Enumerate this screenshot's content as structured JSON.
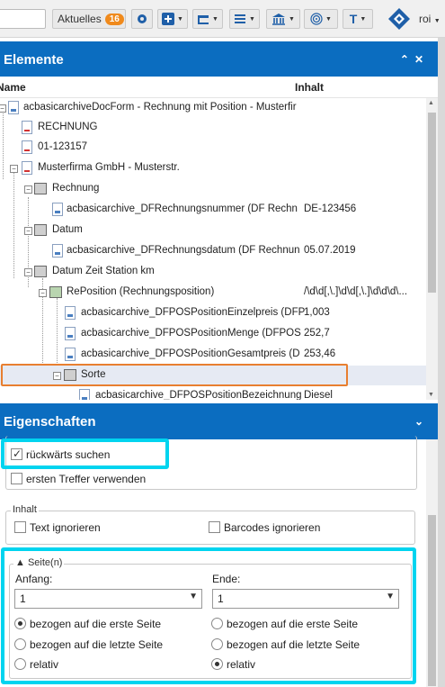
{
  "toolbar": {
    "aktuelles_label": "Aktuelles",
    "aktuelles_count": "16",
    "user_label": "roi"
  },
  "elemente_panel": {
    "title": "Elemente",
    "col_name": "Name",
    "col_inhalt": "Inhalt",
    "rows": [
      {
        "label": "acbasicarchiveDocForm - Rechnung mit Position - Musterfir",
        "value": ""
      },
      {
        "label": "RECHNUNG",
        "value": ""
      },
      {
        "label": "01-123157",
        "value": ""
      },
      {
        "label": "Musterfirma GmbH - Musterstr.",
        "value": ""
      },
      {
        "label": "Rechnung",
        "value": ""
      },
      {
        "label": "acbasicarchive_DFRechnungsnummer (DF Rechn",
        "value": "DE-123456"
      },
      {
        "label": "Datum",
        "value": ""
      },
      {
        "label": "acbasicarchive_DFRechnungsdatum (DF Rechnun",
        "value": "05.07.2019"
      },
      {
        "label": "Datum Zeit Station km",
        "value": ""
      },
      {
        "label": "RePosition (Rechnungsposition)",
        "value": "/\\d\\d[,\\.]\\d\\d[,\\.]\\d\\d\\d\\..."
      },
      {
        "label": "acbasicarchive_DFPOSPositionEinzelpreis (DFP",
        "value": "1,003"
      },
      {
        "label": "acbasicarchive_DFPOSPositionMenge (DFPOS",
        "value": "252,7"
      },
      {
        "label": "acbasicarchive_DFPOSPositionGesamtpreis (D",
        "value": "253,46"
      },
      {
        "label": "Sorte",
        "value": ""
      },
      {
        "label": "acbasicarchive_DFPOSPositionBezeichnung",
        "value": "Diesel"
      }
    ]
  },
  "eigenschaften_panel": {
    "title": "Eigenschaften",
    "rueckwaerts_suchen": "rückwärts suchen",
    "ersten_treffer": "ersten Treffer verwenden",
    "inhalt_legend": "Inhalt",
    "text_ignorieren": "Text ignorieren",
    "barcodes_ignorieren": "Barcodes ignorieren",
    "seiten_legend": "Seite(n)",
    "anfang_label": "Anfang:",
    "ende_label": "Ende:",
    "anfang_value": "1",
    "ende_value": "1",
    "opt_erste": "bezogen auf die erste Seite",
    "opt_letzte": "bezogen auf die letzte Seite",
    "opt_relativ": "relativ"
  }
}
